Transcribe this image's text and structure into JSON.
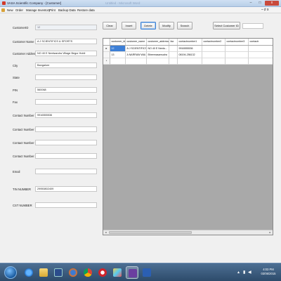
{
  "window": {
    "title": "VASA Scientific Company - [Customer]",
    "background_title": "Untitled - Microsoft Word",
    "controls": {
      "minimize": "–",
      "maximize": "□",
      "close": "x"
    },
    "mdi_controls": "– ♯ x"
  },
  "menu": {
    "items": [
      "New",
      "Order",
      "Manage Inventory",
      "Print",
      "Backup Data",
      "Restore data"
    ]
  },
  "form": {
    "fields": [
      {
        "label": "CustomerID",
        "value": "12",
        "readonly": true
      },
      {
        "label": "Customer Name",
        "value": "A J SCIENTIFICS & SPORTS"
      },
      {
        "label": "Customer Address",
        "value": "NO 40 E Neelsandra Village Begur Hobli"
      },
      {
        "label": "City",
        "value": "Bangalore"
      },
      {
        "label": "State",
        "value": ""
      },
      {
        "label": "PIN",
        "value": "560068"
      },
      {
        "label": "Fax",
        "value": ""
      },
      {
        "label": "Contact Number 1",
        "value": "9916555536"
      },
      {
        "label": "Contact Number 2",
        "value": ""
      },
      {
        "label": "Contact Number 3",
        "value": ""
      },
      {
        "label": "Contact Number 4",
        "value": ""
      },
      {
        "label": "Email",
        "value": ""
      },
      {
        "label": "TIN NUMBER",
        "value": "29950802409"
      },
      {
        "label": "CST NUMBER",
        "value": ""
      }
    ]
  },
  "toolbar": {
    "clear": "Clear",
    "insert": "Insert",
    "delete": "Delete",
    "modify": "Modify",
    "search": "Search",
    "select_customer": "Select Customer ID",
    "search_value": ""
  },
  "grid": {
    "columns": [
      "customer_id",
      "customer_name",
      "customer_address",
      "fax",
      "contactnumber1",
      "contactnumber2",
      "contactnumber3",
      "contactr"
    ],
    "rows": [
      {
        "indicator": "▸",
        "cells": [
          "12",
          "A J SCIENTIFICS...",
          "NO 40 E Neela...",
          "",
          "9916555536",
          "",
          "",
          ""
        ]
      },
      {
        "indicator": "",
        "cells": [
          "13",
          "A NARRAW WAI...",
          "Bheemasamudra",
          "",
          "08194-256132",
          "",
          "",
          ""
        ]
      },
      {
        "indicator": "*",
        "cells": [
          "",
          "",
          "",
          "",
          "",
          "",
          "",
          ""
        ]
      }
    ]
  },
  "taskbar": {
    "tray": {
      "time": "4:03 PM",
      "date": "03/06/2015"
    }
  }
}
